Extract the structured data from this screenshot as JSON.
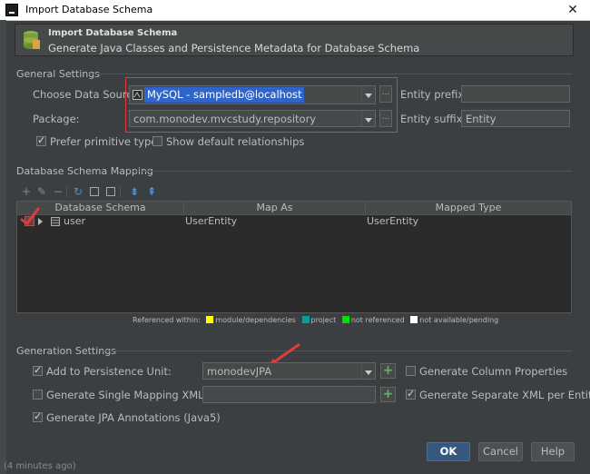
{
  "window": {
    "title": "Import Database Schema"
  },
  "header": {
    "title": "Import Database Schema",
    "subtitle": "Generate Java Classes and Persistence Metadata for Database Schema"
  },
  "general": {
    "section_title": "General Settings",
    "datasource_label": "Choose Data Source:",
    "datasource_value": "MySQL - sampledb@localhost",
    "package_label": "Package:",
    "package_value": "com.monodev.mvcstudy.repository",
    "entity_prefix_label": "Entity prefix:",
    "entity_prefix_value": "",
    "entity_suffix_label": "Entity suffix:",
    "entity_suffix_value": "Entity",
    "prefer_primitive_label": "Prefer primitive types",
    "prefer_primitive_checked": true,
    "show_default_label": "Show default relationships",
    "show_default_checked": false,
    "more_button": "..."
  },
  "mapping": {
    "section_title": "Database Schema Mapping",
    "columns": [
      "Database Schema",
      "Map As",
      "Mapped Type"
    ],
    "rows": [
      {
        "schema": "user",
        "map_as": "UserEntity",
        "mapped_type": "UserEntity"
      }
    ],
    "legend_prefix": "Referenced within:",
    "legend": [
      {
        "label": "module/dependencies",
        "color": "#ffff00"
      },
      {
        "label": "project",
        "color": "#00a0a0"
      },
      {
        "label": "not referenced",
        "color": "#00e000"
      },
      {
        "label": "not available/pending",
        "color": "#ffffff"
      }
    ]
  },
  "generation": {
    "section_title": "Generation Settings",
    "add_persistence_label": "Add to Persistence Unit:",
    "add_persistence_checked": true,
    "persistence_unit_value": "monodevJPA",
    "single_mapping_label": "Generate Single Mapping XML:",
    "single_mapping_checked": false,
    "single_mapping_value": "",
    "jpa_annotations_label": "Generate JPA Annotations (Java5)",
    "jpa_annotations_checked": true,
    "column_props_label": "Generate Column Properties",
    "column_props_checked": false,
    "separate_xml_label": "Generate Separate XML per Entity",
    "separate_xml_checked": true,
    "add_button": "+"
  },
  "buttons": {
    "ok": "OK",
    "cancel": "Cancel",
    "help": "Help"
  },
  "background_text": "(4 minutes ago)",
  "colors": {
    "bg": "#3c3f41",
    "accent_red": "#e23b3b",
    "selection": "#2f65ca",
    "ok_button": "#365880"
  }
}
